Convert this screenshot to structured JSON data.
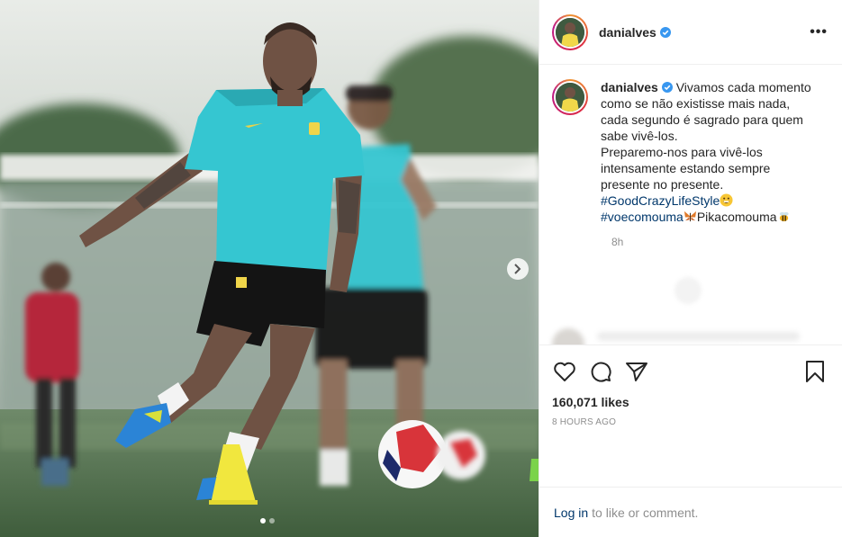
{
  "post": {
    "username": "danialves",
    "verified": true,
    "caption_lines": [
      "Vivamos cada momento como se não existisse mais nada, cada segundo é sagrado para quem sabe vivê-los.",
      "Preparemo-nos para vivê-los intensamente estando sempre presente no presente."
    ],
    "hashtag_1": "#GoodCrazyLifeStyle",
    "hashtag_2": "#voecomouma",
    "caption_tail": "Pikacomouma",
    "caption_time": "8h",
    "likes_text": "160,071 likes",
    "posted_ago": "8 HOURS AGO",
    "login_link": "Log in",
    "login_rest": "to like or comment.",
    "carousel": {
      "current": 1,
      "total": 2
    }
  },
  "icons": {
    "more": "more-options-icon",
    "like": "heart-icon",
    "comment": "comment-bubble-icon",
    "share": "paper-plane-icon",
    "save": "bookmark-icon",
    "next": "chevron-right-icon",
    "verified": "verified-badge-icon"
  },
  "colors": {
    "link": "#00376b",
    "verified": "#3897f0",
    "muted": "#8e8e8e",
    "jersey": "#35c6d1"
  }
}
